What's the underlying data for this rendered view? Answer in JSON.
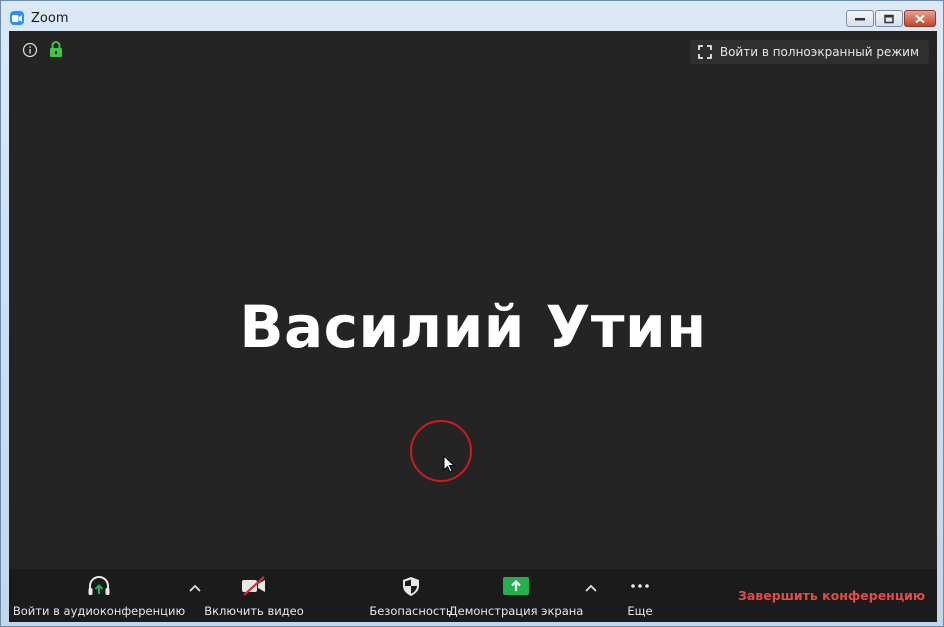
{
  "window": {
    "title": "Zoom"
  },
  "top_bar": {
    "fullscreen_label": "Войти в полноэкранный режим"
  },
  "participant": {
    "name": "Василий Утин"
  },
  "toolbar": {
    "audio_label": "Войти в аудиоконференцию",
    "video_label": "Включить видео",
    "security_label": "Безопасность",
    "share_label": "Демонстрация экрана",
    "more_label": "Еще",
    "end_label": "Завершить конференцию"
  },
  "colors": {
    "background": "#242424",
    "toolbar": "#1b1b1b",
    "share_green": "#22b14c",
    "lock_green": "#41c441",
    "end_red": "#e54b4b",
    "cursor_ring": "#d11a1a"
  },
  "icons": {
    "info": "info-icon",
    "lock": "lock-icon",
    "fullscreen": "fullscreen-icon",
    "headphones": "headphones-icon",
    "video_off": "video-off-icon",
    "shield": "shield-icon",
    "share": "share-screen-icon",
    "more": "more-icon",
    "caret": "chevron-up-icon"
  }
}
